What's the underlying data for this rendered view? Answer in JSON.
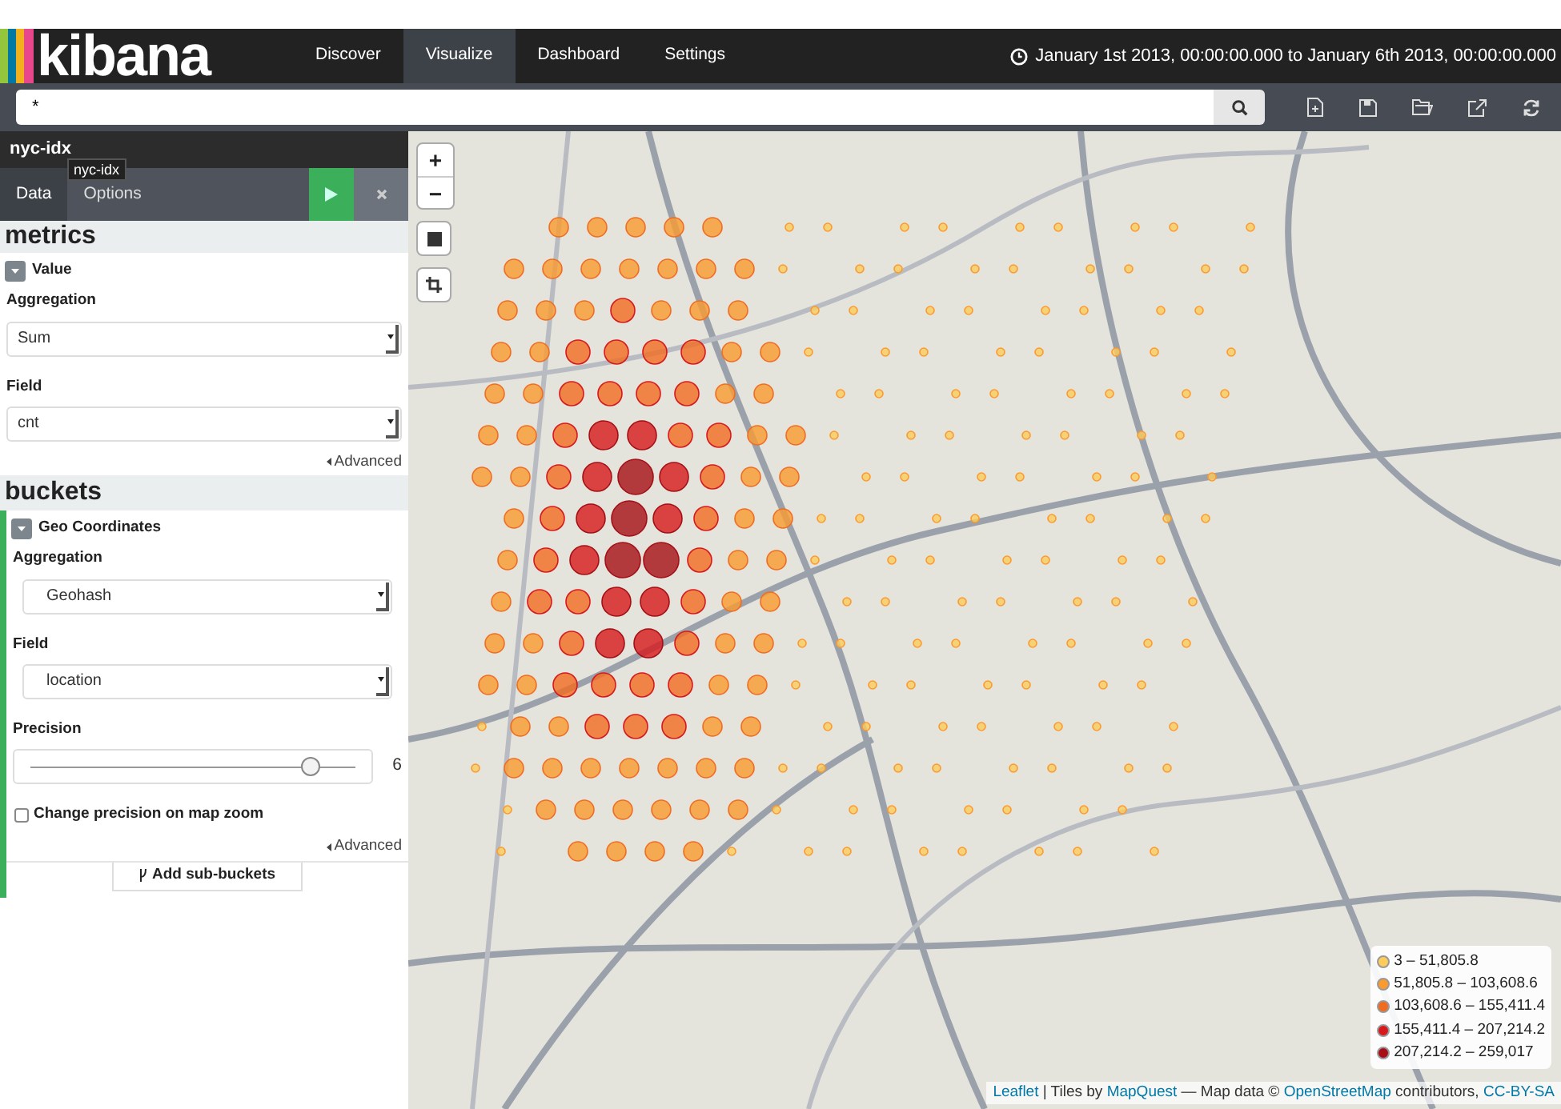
{
  "logo": {
    "text": "kibana"
  },
  "nav": [
    {
      "label": "Discover",
      "selected": false
    },
    {
      "label": "Visualize",
      "selected": true
    },
    {
      "label": "Dashboard",
      "selected": false
    },
    {
      "label": "Settings",
      "selected": false
    }
  ],
  "time_range": "January 1st 2013, 00:00:00.000 to January 6th 2013, 00:00:00.000",
  "search": {
    "value": "*"
  },
  "sidebar": {
    "index_title": "nyc-idx",
    "tooltip": "nyc-idx",
    "tabs": [
      {
        "label": "Data",
        "selected": true
      },
      {
        "label": "Options",
        "selected": false
      }
    ],
    "metrics": {
      "heading": "metrics",
      "agg_title": "Value",
      "fields": [
        {
          "label": "Aggregation",
          "value": "Sum"
        },
        {
          "label": "Field",
          "value": "cnt"
        }
      ],
      "advanced": "Advanced"
    },
    "buckets": {
      "heading": "buckets",
      "agg_title": "Geo Coordinates",
      "fields": [
        {
          "label": "Aggregation",
          "value": "Geohash"
        },
        {
          "label": "Field",
          "value": "location"
        }
      ],
      "precision": {
        "label": "Precision",
        "level": 0.86,
        "reading": "6"
      },
      "zoom_checkbox": {
        "label": "Change precision on map zoom",
        "checked": false
      },
      "advanced": "Advanced",
      "add_button": "Add sub-buckets"
    }
  },
  "map": {
    "controls": [
      "+",
      "−"
    ],
    "legend": [
      {
        "label": "3 – 51,805.8",
        "color": "#fdcc5c"
      },
      {
        "label": "51,805.8 – 103,608.6",
        "color": "#f99b2f"
      },
      {
        "label": "103,608.6 – 155,411.4",
        "color": "#f16c21"
      },
      {
        "label": "155,411.4 – 207,214.2",
        "color": "#d7191c"
      },
      {
        "label": "207,214.2 – 259,017",
        "color": "#a50f15"
      }
    ],
    "attribution": [
      {
        "text": "Leaflet",
        "link": true
      },
      {
        "text": " | Tiles by ",
        "link": false
      },
      {
        "text": "MapQuest",
        "link": true
      },
      {
        "text": " — Map data © ",
        "link": false
      },
      {
        "text": "OpenStreetMap",
        "link": true
      },
      {
        "text": " contributors, ",
        "link": false
      },
      {
        "text": "CC-BY-SA",
        "link": true
      }
    ]
  }
}
